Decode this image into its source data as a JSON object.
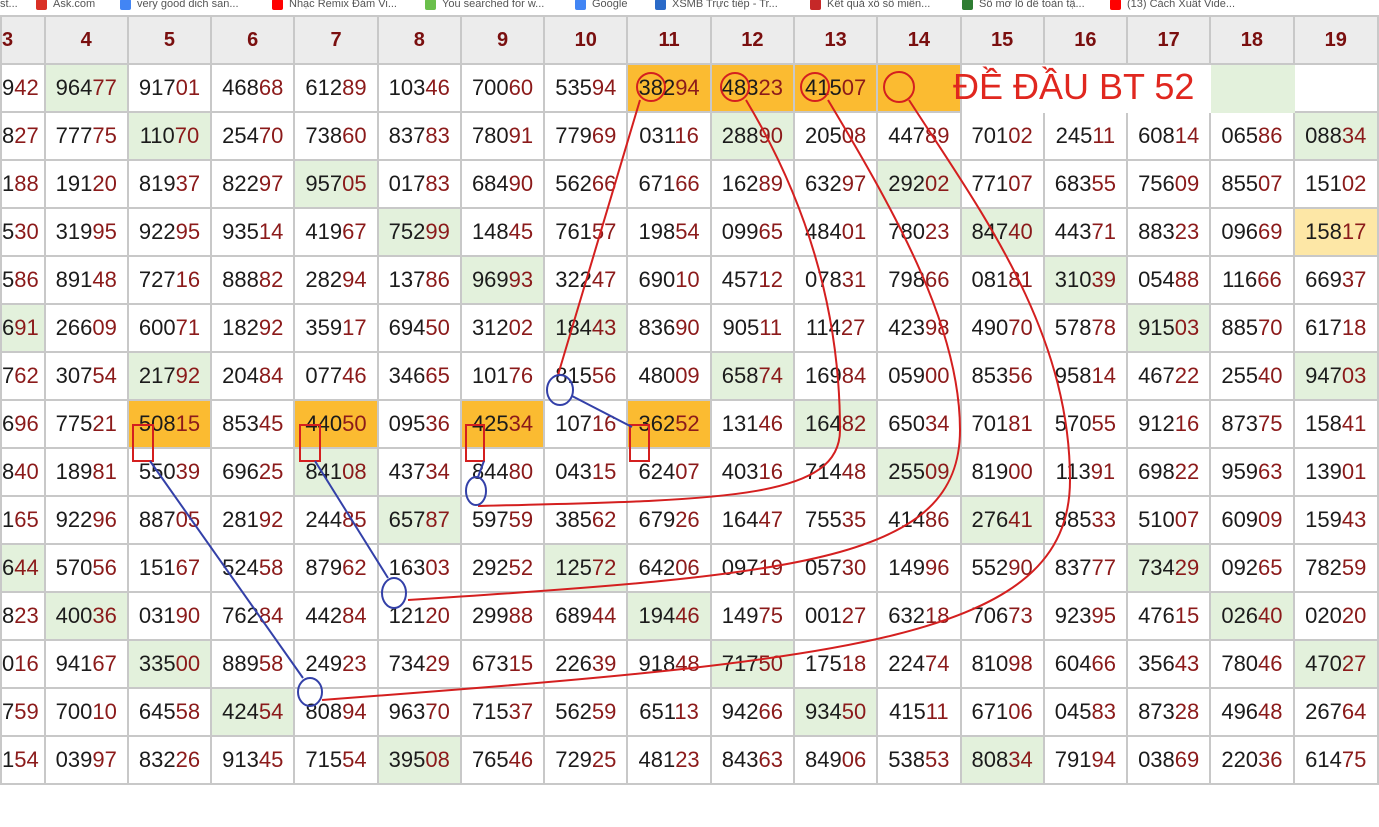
{
  "bookmarks": [
    {
      "label": "st...",
      "color": "#888888"
    },
    {
      "label": "Ask.com",
      "color": "#d93025"
    },
    {
      "label": "very good dich san...",
      "color": "#4285f4"
    },
    {
      "label": "Nhạc Remix Đám Vi...",
      "color": "#ff0000"
    },
    {
      "label": "You searched for w...",
      "color": "#6abf4b"
    },
    {
      "label": "Google",
      "color": "#4285f4"
    },
    {
      "label": "XSMB Trực tiếp - Tr...",
      "color": "#2a6ac8"
    },
    {
      "label": "Kết quả xổ số miền...",
      "color": "#c62828"
    },
    {
      "label": "Sổ mơ lô đề toàn tậ...",
      "color": "#2e7d32"
    },
    {
      "label": "(13) Cách Xuất Vide...",
      "color": "#ff0000"
    }
  ],
  "headers": [
    "3",
    "4",
    "5",
    "6",
    "7",
    "8",
    "9",
    "10",
    "11",
    "12",
    "13",
    "14",
    "15",
    "16",
    "17",
    "18",
    "19"
  ],
  "rows": [
    [
      "942",
      "96477",
      "91701",
      "46868",
      "61289",
      "10346",
      "70060",
      "53594",
      "38294",
      "48323",
      "41507",
      "",
      "",
      "",
      "",
      "",
      ""
    ],
    [
      "827",
      "77775",
      "11070",
      "25470",
      "73860",
      "83783",
      "78091",
      "77969",
      "03116",
      "28890",
      "20508",
      "44789",
      "70102",
      "24511",
      "60814",
      "06586",
      "08834"
    ],
    [
      "188",
      "19120",
      "81937",
      "82297",
      "95705",
      "01783",
      "68490",
      "56266",
      "67166",
      "16289",
      "63297",
      "29202",
      "77107",
      "68355",
      "75609",
      "85507",
      "15102"
    ],
    [
      "530",
      "31995",
      "92295",
      "93514",
      "41967",
      "75299",
      "14845",
      "76157",
      "19854",
      "09965",
      "48401",
      "78023",
      "84740",
      "44371",
      "88323",
      "09669",
      "15817"
    ],
    [
      "586",
      "89148",
      "72716",
      "88882",
      "28294",
      "13786",
      "96993",
      "32247",
      "69010",
      "45712",
      "07831",
      "79866",
      "08181",
      "31039",
      "05488",
      "11666",
      "66937"
    ],
    [
      "691",
      "26609",
      "60071",
      "18292",
      "35917",
      "69450",
      "31202",
      "18443",
      "83690",
      "90511",
      "11427",
      "42398",
      "49070",
      "57878",
      "91503",
      "88570",
      "61718"
    ],
    [
      "762",
      "30754",
      "21792",
      "20484",
      "07746",
      "34665",
      "10176",
      "81556",
      "48009",
      "65874",
      "16984",
      "05900",
      "85356",
      "95814",
      "46722",
      "25540",
      "94703"
    ],
    [
      "696",
      "77521",
      "50815",
      "85345",
      "44050",
      "09536",
      "42534",
      "10716",
      "36252",
      "13146",
      "16482",
      "65034",
      "70181",
      "57055",
      "91216",
      "87375",
      "15841"
    ],
    [
      "840",
      "18981",
      "55039",
      "69625",
      "84108",
      "43734",
      "84480",
      "04315",
      "62407",
      "40316",
      "71448",
      "25509",
      "81900",
      "11391",
      "69822",
      "95963",
      "13901"
    ],
    [
      "165",
      "92296",
      "88705",
      "28192",
      "24485",
      "65787",
      "59759",
      "38562",
      "67926",
      "16447",
      "75535",
      "41486",
      "27641",
      "88533",
      "51007",
      "60909",
      "15943"
    ],
    [
      "644",
      "57056",
      "15167",
      "52458",
      "87962",
      "16303",
      "29252",
      "12572",
      "64206",
      "09719",
      "05730",
      "14996",
      "55290",
      "83777",
      "73429",
      "09265",
      "78259"
    ],
    [
      "823",
      "40036",
      "03190",
      "76284",
      "44284",
      "12120",
      "29988",
      "68944",
      "19446",
      "14975",
      "00127",
      "63218",
      "70673",
      "92395",
      "47615",
      "02640",
      "02020"
    ],
    [
      "016",
      "94167",
      "33500",
      "88958",
      "24923",
      "73429",
      "67315",
      "22639",
      "91848",
      "71750",
      "17518",
      "22474",
      "81098",
      "60466",
      "35643",
      "78046",
      "47027"
    ],
    [
      "759",
      "70010",
      "64558",
      "42454",
      "80894",
      "96370",
      "71537",
      "56259",
      "65113",
      "94266",
      "93450",
      "41511",
      "67106",
      "04583",
      "87328",
      "49648",
      "26764"
    ],
    [
      "154",
      "03997",
      "83226",
      "91345",
      "71554",
      "39508",
      "76546",
      "72925",
      "48123",
      "84363",
      "84906",
      "53853",
      "80834",
      "79194",
      "03869",
      "22036",
      "61475"
    ]
  ],
  "highlights": {
    "green": [
      [
        0,
        1
      ],
      [
        1,
        2
      ],
      [
        1,
        9
      ],
      [
        1,
        16
      ],
      [
        2,
        4
      ],
      [
        2,
        11
      ],
      [
        3,
        5
      ],
      [
        3,
        12
      ],
      [
        4,
        6
      ],
      [
        4,
        13
      ],
      [
        5,
        0
      ],
      [
        5,
        7
      ],
      [
        5,
        14
      ],
      [
        6,
        2
      ],
      [
        6,
        9
      ],
      [
        6,
        16
      ],
      [
        7,
        10
      ],
      [
        8,
        4
      ],
      [
        8,
        11
      ],
      [
        9,
        5
      ],
      [
        9,
        12
      ],
      [
        10,
        0
      ],
      [
        10,
        7
      ],
      [
        10,
        14
      ],
      [
        11,
        1
      ],
      [
        11,
        8
      ],
      [
        11,
        15
      ],
      [
        12,
        2
      ],
      [
        12,
        9
      ],
      [
        12,
        16
      ],
      [
        13,
        3
      ],
      [
        13,
        10
      ],
      [
        14,
        5
      ],
      [
        14,
        12
      ]
    ],
    "orange": [
      [
        0,
        8
      ],
      [
        0,
        9
      ],
      [
        0,
        10
      ],
      [
        0,
        11
      ],
      [
        7,
        2
      ],
      [
        7,
        4
      ],
      [
        7,
        6
      ],
      [
        7,
        8
      ]
    ],
    "light_orange": [
      [
        3,
        16
      ]
    ],
    "pale_green": [
      [
        0,
        12
      ],
      [
        0,
        13
      ],
      [
        0,
        14
      ],
      [
        0,
        15
      ]
    ]
  },
  "annotation": {
    "title": "ĐỀ ĐẦU BT 52"
  },
  "colors": {
    "red_line": "#d41f1f",
    "blue_line": "#3340a8",
    "orange": "#fbbb31",
    "green": "#e3f1dc",
    "header_bg": "#ececec"
  }
}
